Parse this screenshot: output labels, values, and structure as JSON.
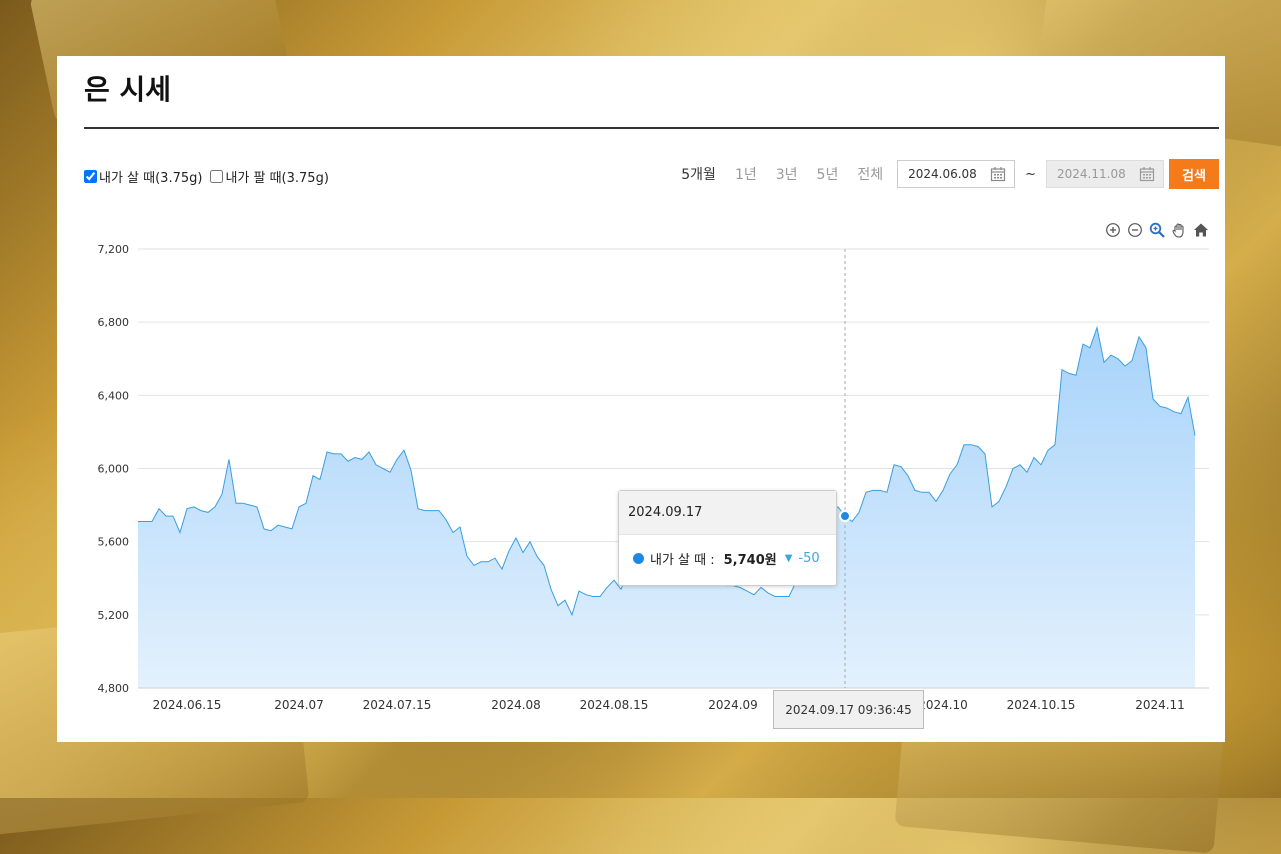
{
  "page": {
    "title": "은 시세"
  },
  "filters": {
    "buy_label": "내가 살 때(3.75g)",
    "buy_checked": true,
    "sell_label": "내가 팔 때(3.75g)",
    "sell_checked": false
  },
  "periods": [
    {
      "label": "5개월",
      "active": true
    },
    {
      "label": "1년",
      "active": false
    },
    {
      "label": "3년",
      "active": false
    },
    {
      "label": "5년",
      "active": false
    },
    {
      "label": "전체",
      "active": false
    }
  ],
  "date_range": {
    "start": "2024.06.08",
    "separator": "~",
    "end": "2024.11.08"
  },
  "search_button": "검색",
  "tooltip": {
    "date": "2024.09.17",
    "series_label": "내가 살 때 :",
    "value": "5,740원",
    "change_arrow": "▼",
    "change": "-50"
  },
  "crosshair_label": "2024.09.17 09:36:45",
  "colors": {
    "accent": "#f57a1a",
    "line": "#3a9ee0",
    "area_top": "#a7d3fa",
    "area_bottom": "#e3f1fd",
    "marker": "#1e88e5"
  },
  "chart_data": {
    "type": "area",
    "title": "",
    "xlabel": "",
    "ylabel": "",
    "ylim": [
      4800,
      7200
    ],
    "yticks": [
      "4,800",
      "5,200",
      "5,600",
      "6,000",
      "6,400",
      "6,800",
      "7,200"
    ],
    "ytick_values": [
      4800,
      5200,
      5600,
      6000,
      6400,
      6800,
      7200
    ],
    "xticks": [
      {
        "label": "2024.06.15",
        "date": "2024-06-15"
      },
      {
        "label": "2024.07",
        "date": "2024-07-01"
      },
      {
        "label": "2024.07.15",
        "date": "2024-07-15"
      },
      {
        "label": "2024.08",
        "date": "2024-08-01"
      },
      {
        "label": "2024.08.15",
        "date": "2024-08-15"
      },
      {
        "label": "2024.09",
        "date": "2024-09-01"
      },
      {
        "label": "2024.10",
        "date": "2024-10-01"
      },
      {
        "label": "2024.10.15",
        "date": "2024-10-15"
      },
      {
        "label": "2024.11",
        "date": "2024-11-01"
      }
    ],
    "xrange": [
      "2024-06-08",
      "2024-11-08"
    ],
    "grid": true,
    "highlight": {
      "date": "2024-09-17",
      "value": 5740
    },
    "series": [
      {
        "name": "내가 살 때",
        "points": [
          [
            "2024-06-08",
            5710
          ],
          [
            "2024-06-09",
            5710
          ],
          [
            "2024-06-10",
            5710
          ],
          [
            "2024-06-11",
            5780
          ],
          [
            "2024-06-12",
            5740
          ],
          [
            "2024-06-13",
            5740
          ],
          [
            "2024-06-14",
            5650
          ],
          [
            "2024-06-15",
            5780
          ],
          [
            "2024-06-16",
            5790
          ],
          [
            "2024-06-17",
            5770
          ],
          [
            "2024-06-18",
            5760
          ],
          [
            "2024-06-19",
            5790
          ],
          [
            "2024-06-20",
            5860
          ],
          [
            "2024-06-21",
            6050
          ],
          [
            "2024-06-22",
            5810
          ],
          [
            "2024-06-23",
            5810
          ],
          [
            "2024-06-24",
            5800
          ],
          [
            "2024-06-25",
            5790
          ],
          [
            "2024-06-26",
            5670
          ],
          [
            "2024-06-27",
            5660
          ],
          [
            "2024-06-28",
            5690
          ],
          [
            "2024-06-29",
            5680
          ],
          [
            "2024-06-30",
            5670
          ],
          [
            "2024-07-01",
            5790
          ],
          [
            "2024-07-02",
            5810
          ],
          [
            "2024-07-03",
            5960
          ],
          [
            "2024-07-04",
            5940
          ],
          [
            "2024-07-05",
            6090
          ],
          [
            "2024-07-06",
            6080
          ],
          [
            "2024-07-07",
            6080
          ],
          [
            "2024-07-08",
            6040
          ],
          [
            "2024-07-09",
            6060
          ],
          [
            "2024-07-10",
            6050
          ],
          [
            "2024-07-11",
            6090
          ],
          [
            "2024-07-12",
            6020
          ],
          [
            "2024-07-13",
            6000
          ],
          [
            "2024-07-14",
            5980
          ],
          [
            "2024-07-15",
            6050
          ],
          [
            "2024-07-16",
            6100
          ],
          [
            "2024-07-17",
            5990
          ],
          [
            "2024-07-18",
            5780
          ],
          [
            "2024-07-19",
            5770
          ],
          [
            "2024-07-20",
            5770
          ],
          [
            "2024-07-21",
            5770
          ],
          [
            "2024-07-22",
            5720
          ],
          [
            "2024-07-23",
            5650
          ],
          [
            "2024-07-24",
            5680
          ],
          [
            "2024-07-25",
            5520
          ],
          [
            "2024-07-26",
            5470
          ],
          [
            "2024-07-27",
            5490
          ],
          [
            "2024-07-28",
            5490
          ],
          [
            "2024-07-29",
            5510
          ],
          [
            "2024-07-30",
            5450
          ],
          [
            "2024-07-31",
            5550
          ],
          [
            "2024-08-01",
            5620
          ],
          [
            "2024-08-02",
            5540
          ],
          [
            "2024-08-03",
            5600
          ],
          [
            "2024-08-04",
            5520
          ],
          [
            "2024-08-05",
            5470
          ],
          [
            "2024-08-06",
            5340
          ],
          [
            "2024-08-07",
            5250
          ],
          [
            "2024-08-08",
            5280
          ],
          [
            "2024-08-09",
            5200
          ],
          [
            "2024-08-10",
            5330
          ],
          [
            "2024-08-11",
            5310
          ],
          [
            "2024-08-12",
            5300
          ],
          [
            "2024-08-13",
            5300
          ],
          [
            "2024-08-14",
            5350
          ],
          [
            "2024-08-15",
            5390
          ],
          [
            "2024-08-16",
            5340
          ],
          [
            "2024-08-17",
            5430
          ],
          [
            "2024-08-18",
            5430
          ],
          [
            "2024-08-19",
            5420
          ],
          [
            "2024-08-20",
            5450
          ],
          [
            "2024-08-21",
            5430
          ],
          [
            "2024-08-22",
            5470
          ],
          [
            "2024-08-23",
            5440
          ],
          [
            "2024-08-24",
            5440
          ],
          [
            "2024-08-25",
            5440
          ],
          [
            "2024-08-26",
            5440
          ],
          [
            "2024-08-27",
            5430
          ],
          [
            "2024-08-28",
            5400
          ],
          [
            "2024-08-29",
            5380
          ],
          [
            "2024-08-30",
            5370
          ],
          [
            "2024-08-31",
            5360
          ],
          [
            "2024-09-01",
            5360
          ],
          [
            "2024-09-02",
            5350
          ],
          [
            "2024-09-03",
            5330
          ],
          [
            "2024-09-04",
            5310
          ],
          [
            "2024-09-05",
            5350
          ],
          [
            "2024-09-06",
            5320
          ],
          [
            "2024-09-07",
            5300
          ],
          [
            "2024-09-08",
            5300
          ],
          [
            "2024-09-09",
            5300
          ],
          [
            "2024-09-10",
            5380
          ],
          [
            "2024-09-11",
            5420
          ],
          [
            "2024-09-12",
            5620
          ],
          [
            "2024-09-13",
            5750
          ],
          [
            "2024-09-14",
            5780
          ],
          [
            "2024-09-15",
            5780
          ],
          [
            "2024-09-16",
            5790
          ],
          [
            "2024-09-17",
            5740
          ],
          [
            "2024-09-18",
            5710
          ],
          [
            "2024-09-19",
            5760
          ],
          [
            "2024-09-20",
            5870
          ],
          [
            "2024-09-21",
            5880
          ],
          [
            "2024-09-22",
            5880
          ],
          [
            "2024-09-23",
            5870
          ],
          [
            "2024-09-24",
            6020
          ],
          [
            "2024-09-25",
            6010
          ],
          [
            "2024-09-26",
            5960
          ],
          [
            "2024-09-27",
            5880
          ],
          [
            "2024-09-28",
            5870
          ],
          [
            "2024-09-29",
            5870
          ],
          [
            "2024-09-30",
            5820
          ],
          [
            "2024-10-01",
            5880
          ],
          [
            "2024-10-02",
            5970
          ],
          [
            "2024-10-03",
            6020
          ],
          [
            "2024-10-04",
            6130
          ],
          [
            "2024-10-05",
            6130
          ],
          [
            "2024-10-06",
            6120
          ],
          [
            "2024-10-07",
            6080
          ],
          [
            "2024-10-08",
            5790
          ],
          [
            "2024-10-09",
            5820
          ],
          [
            "2024-10-10",
            5900
          ],
          [
            "2024-10-11",
            6000
          ],
          [
            "2024-10-12",
            6020
          ],
          [
            "2024-10-13",
            5980
          ],
          [
            "2024-10-14",
            6060
          ],
          [
            "2024-10-15",
            6020
          ],
          [
            "2024-10-16",
            6100
          ],
          [
            "2024-10-17",
            6130
          ],
          [
            "2024-10-18",
            6540
          ],
          [
            "2024-10-19",
            6520
          ],
          [
            "2024-10-20",
            6510
          ],
          [
            "2024-10-21",
            6680
          ],
          [
            "2024-10-22",
            6660
          ],
          [
            "2024-10-23",
            6770
          ],
          [
            "2024-10-24",
            6580
          ],
          [
            "2024-10-25",
            6620
          ],
          [
            "2024-10-26",
            6600
          ],
          [
            "2024-10-27",
            6560
          ],
          [
            "2024-10-28",
            6590
          ],
          [
            "2024-10-29",
            6720
          ],
          [
            "2024-10-30",
            6660
          ],
          [
            "2024-10-31",
            6380
          ],
          [
            "2024-11-01",
            6340
          ],
          [
            "2024-11-02",
            6330
          ],
          [
            "2024-11-03",
            6310
          ],
          [
            "2024-11-04",
            6300
          ],
          [
            "2024-11-05",
            6390
          ],
          [
            "2024-11-06",
            6180
          ]
        ]
      }
    ]
  }
}
